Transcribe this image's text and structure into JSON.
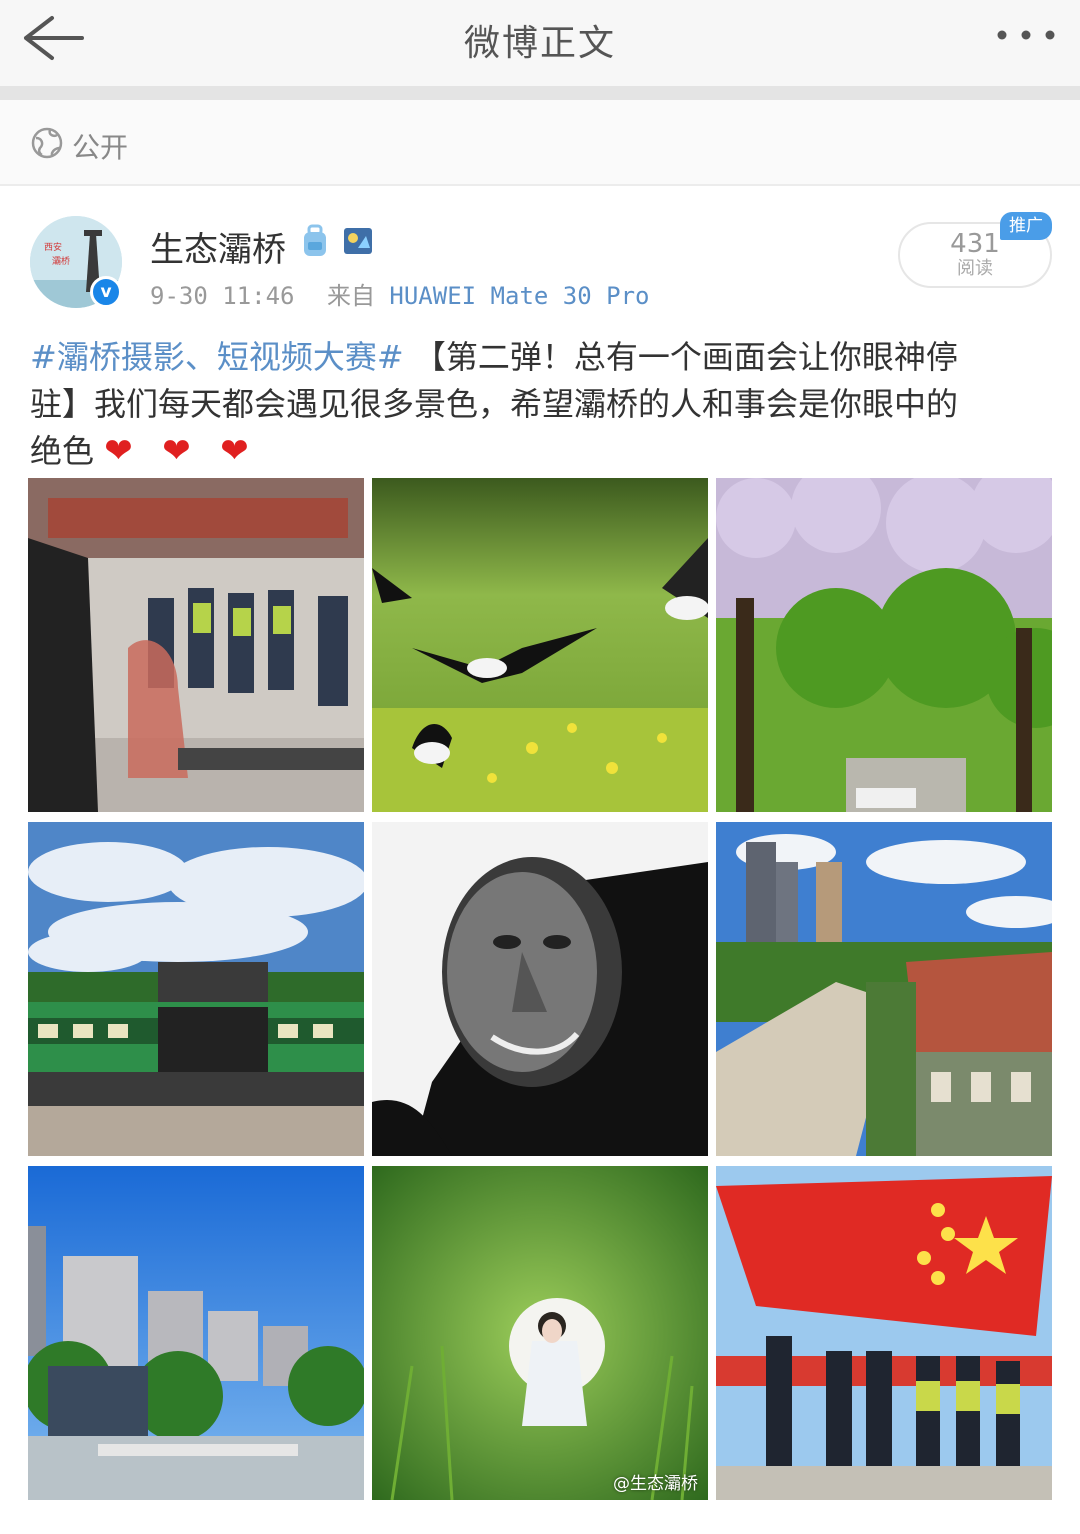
{
  "nav": {
    "title": "微博正文"
  },
  "visibility": {
    "label": "公开"
  },
  "post": {
    "username": "生态灞桥",
    "time": "9-30 11:46",
    "source_prefix": "来自",
    "device": "HUAWEI Mate 30 Pro",
    "reads": "431",
    "reads_label": "阅读",
    "promo_badge": "推广",
    "hashtag": "#灞桥摄影、短视频大赛#",
    "text_line1": "【第二弹！总有一个画面会让你眼神停",
    "text_line2": "驻】我们每天都会遇见很多景色，希望灞桥的人和事会是你眼中的",
    "text_line3": "绝色",
    "hearts": "❤❤❤",
    "avatar_text_1": "西安",
    "avatar_text_2": "灞桥"
  },
  "images": [
    {
      "name": "image-officers-saluting-tollgate",
      "icon": "photo"
    },
    {
      "name": "image-stilt-birds-grass",
      "icon": "photo"
    },
    {
      "name": "image-blossom-tree-avenue",
      "icon": "photo"
    },
    {
      "name": "image-green-train-sky",
      "icon": "photo"
    },
    {
      "name": "image-elderly-man-portrait-bw",
      "icon": "photo"
    },
    {
      "name": "image-village-buildings",
      "icon": "photo"
    },
    {
      "name": "image-city-towers-blue-sky",
      "icon": "photo"
    },
    {
      "name": "image-woman-white-dress-grass",
      "icon": "photo"
    },
    {
      "name": "image-national-flag-police",
      "icon": "photo"
    }
  ],
  "watermark": "@生态灞桥",
  "colors": {
    "link": "#5b8fc7",
    "verified": "#1a86e8",
    "heart": "#e02020",
    "promo": "#4a9de8"
  }
}
